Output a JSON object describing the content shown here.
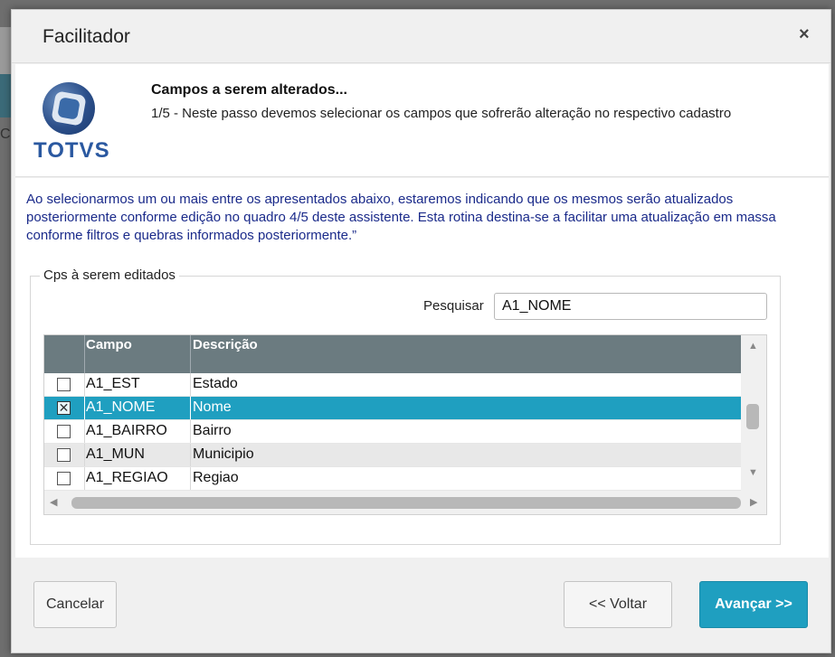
{
  "window": {
    "title": "Facilitador",
    "close_label": "×"
  },
  "background": {
    "edge_letter": "C"
  },
  "header": {
    "logo_text": "TOTVS",
    "step_title": "Campos a serem alterados...",
    "step_description": "1/5 - Neste passo devemos selecionar os campos que sofrerão alteração no respectivo cadastro"
  },
  "intro_text": "Ao selecionarmos um ou mais entre os apresentados abaixo, estaremos indicando que os mesmos serão atualizados posteriormente conforme edição no quadro 4/5 deste assistente. Esta rotina destina-se a facilitar uma atualização em massa conforme filtros e quebras informados posteriormente.”",
  "fields_group": {
    "legend": "Cps à serem editados",
    "search_label": "Pesquisar",
    "search_value": "A1_NOME"
  },
  "grid": {
    "columns": [
      "",
      "Campo",
      "Descrição"
    ],
    "rows": [
      {
        "checked": false,
        "campo": "A1_EST",
        "descricao": "Estado"
      },
      {
        "checked": true,
        "campo": "A1_NOME",
        "descricao": "Nome"
      },
      {
        "checked": false,
        "campo": "A1_BAIRRO",
        "descricao": "Bairro"
      },
      {
        "checked": false,
        "campo": "A1_MUN",
        "descricao": "Municipio"
      },
      {
        "checked": false,
        "campo": "A1_REGIAO",
        "descricao": "Regiao"
      }
    ],
    "selected_row": 1
  },
  "footer": {
    "cancel_label": "Cancelar",
    "back_label": "<< Voltar",
    "next_label": "Avançar >>"
  },
  "colors": {
    "accent": "#1f9fc0",
    "grid_header": "#6b7b80",
    "intro_text": "#1a2a8a"
  }
}
